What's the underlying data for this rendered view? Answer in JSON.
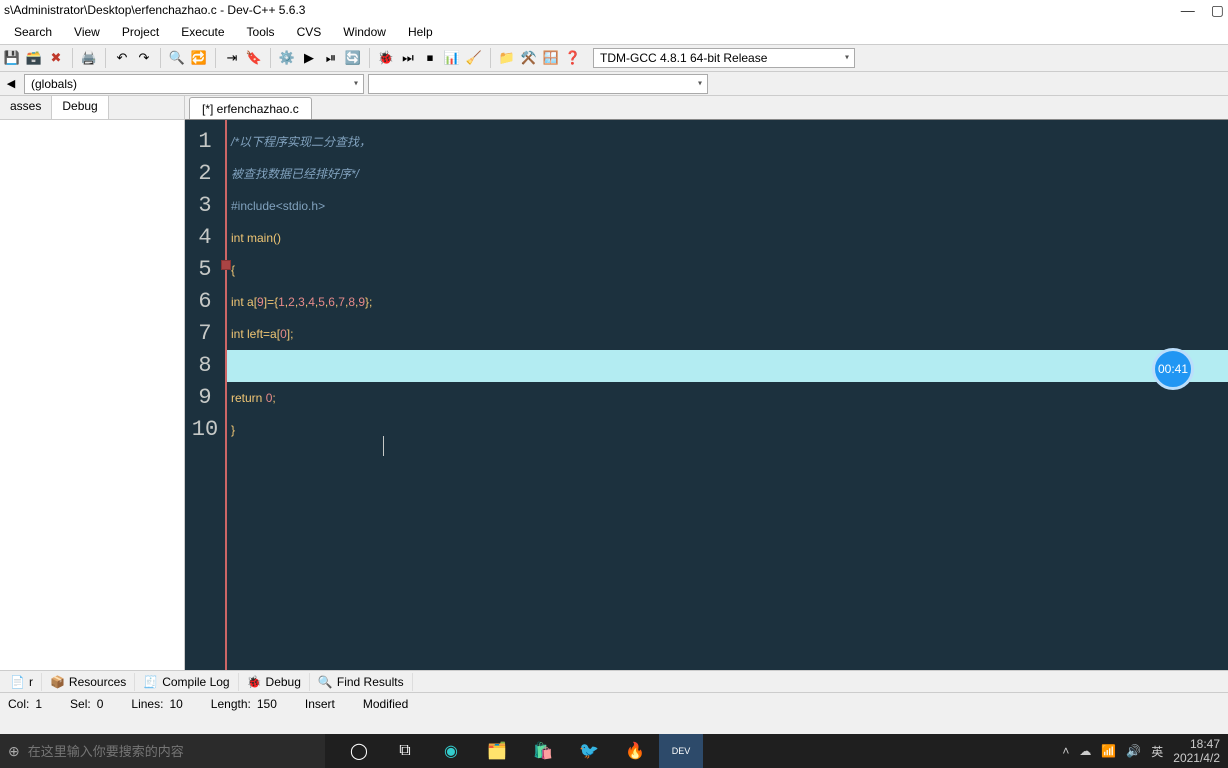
{
  "title": "s\\Administrator\\Desktop\\erfenchazhao.c - Dev-C++ 5.6.3",
  "menu": [
    "Search",
    "View",
    "Project",
    "Execute",
    "Tools",
    "CVS",
    "Window",
    "Help"
  ],
  "compiler": "TDM-GCC 4.8.1 64-bit Release",
  "scope_globals": "(globals)",
  "scope_members": "",
  "left_tabs": [
    "asses",
    "Debug"
  ],
  "file_tab": "[*] erfenchazhao.c",
  "code": {
    "l1": "/*以下程序实现二分查找，",
    "l2": "被查找数据已经排好序*/",
    "l3_a": "#include",
    "l3_b": "<stdio.h>",
    "l4_a": "int ",
    "l4_b": "main",
    "l4_c": "()",
    "l5": "{",
    "l6_a": "int ",
    "l6_b": "a",
    "l6_c": "[",
    "l6_d": "9",
    "l6_e": "]={",
    "l6_f": "1",
    "l6_g": ",",
    "l6_h": "2",
    "l6_i": ",",
    "l6_j": "3",
    "l6_k": ",",
    "l6_l": "4",
    "l6_m": ",",
    "l6_n": "5",
    "l6_o": ",",
    "l6_p": "6",
    "l6_q": ",",
    "l6_r": "7",
    "l6_s": ",",
    "l6_t": "8",
    "l6_u": ",",
    "l6_v": "9",
    "l6_w": "};",
    "l7_a": "int ",
    "l7_b": "left",
    "l7_c": "=",
    "l7_d": "a",
    "l7_e": "[",
    "l7_f": "0",
    "l7_g": "];",
    "l9_a": "return ",
    "l9_b": "0",
    "l9_c": ";",
    "l10": "}"
  },
  "timer": "00:41",
  "bottom_tabs": [
    {
      "icon": "📄",
      "label": "r"
    },
    {
      "icon": "📦",
      "label": "Resources"
    },
    {
      "icon": "🧾",
      "label": "Compile Log"
    },
    {
      "icon": "🐞",
      "label": "Debug"
    },
    {
      "icon": "🔍",
      "label": "Find Results"
    }
  ],
  "status": {
    "col_l": "Col:",
    "col_v": "1",
    "sel_l": "Sel:",
    "sel_v": "0",
    "lines_l": "Lines:",
    "lines_v": "10",
    "len_l": "Length:",
    "len_v": "150",
    "insert": "Insert",
    "modified": "Modified"
  },
  "taskbar": {
    "search_placeholder": "在这里输入你要搜索的内容",
    "ime": "英",
    "time": "18:47",
    "date": "2021/4/2"
  }
}
